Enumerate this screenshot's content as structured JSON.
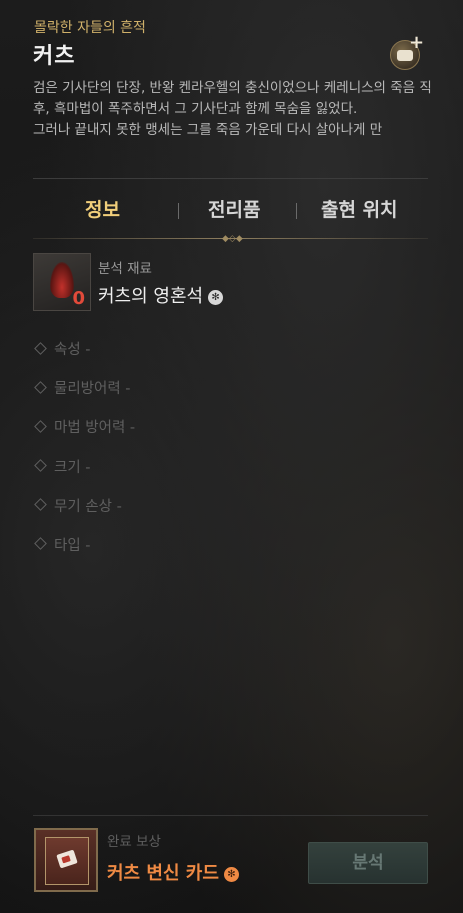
{
  "header": {
    "subtitle": "몰락한 자들의 흔적",
    "title": "커츠",
    "chat_icon": "chat-plus-icon"
  },
  "description": {
    "paragraph1": "검은 기사단의 단장, 반왕 켄라우헬의 충신이었으나 케레니스의 죽음 직후, 흑마법이 폭주하면서 그 기사단과 함께 목숨을 잃었다.",
    "paragraph2": "그러나 끝내지 못한 맹세는 그를 죽음 가운데 다시 살아나게 만"
  },
  "tabs": [
    {
      "label": "정보",
      "active": true
    },
    {
      "label": "전리품",
      "active": false
    },
    {
      "label": "출현 위치",
      "active": false
    }
  ],
  "material": {
    "label": "분석 재료",
    "name": "커츠의 영혼석",
    "count": "0",
    "bind_glyph": "✻"
  },
  "stats": [
    {
      "label": "속성 -"
    },
    {
      "label": "물리방어력 -"
    },
    {
      "label": "마법 방어력 -"
    },
    {
      "label": "크기 -"
    },
    {
      "label": "무기 손상 -"
    },
    {
      "label": "타입 -"
    }
  ],
  "reward": {
    "label": "완료 보상",
    "name": "커츠 변신 카드",
    "bind_glyph": "✻"
  },
  "analyze_button": {
    "label": "분석",
    "enabled": false
  },
  "colors": {
    "accent_gold": "#f1cf7b",
    "subtitle_gold": "#d0b16a",
    "reward_orange": "#ef8a44",
    "count_red": "#e24a3a"
  }
}
